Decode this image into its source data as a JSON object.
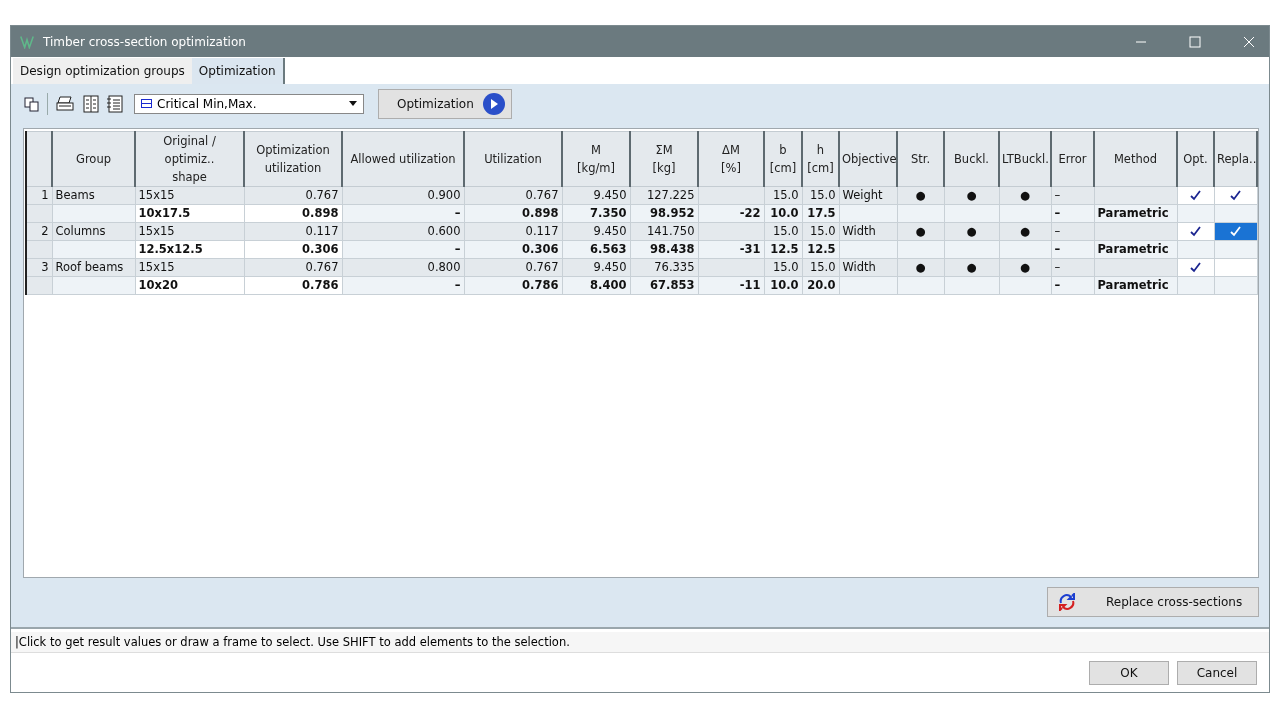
{
  "window": {
    "title": "Timber cross-section optimization"
  },
  "tabs": [
    {
      "label": "Design optimization groups",
      "selected": false
    },
    {
      "label": "Optimization",
      "selected": true
    }
  ],
  "toolbar": {
    "dropdown": {
      "value": "Critical Min,Max."
    },
    "run_button": "Optimization"
  },
  "table": {
    "columns": [
      "",
      "Group",
      "Original / optimiz..\nshape",
      "Optimization\nutilization",
      "Allowed utilization",
      "Utilization",
      "M\n[kg/m]",
      "ΣM\n[kg]",
      "ΔM\n[%]",
      "b\n[cm]",
      "h\n[cm]",
      "Objective",
      "Str.",
      "Buckl.",
      "LTBuckl.",
      "Error",
      "Method",
      "Opt.",
      "Repla.."
    ],
    "rows": [
      {
        "kind": "original",
        "cells": [
          "1",
          "Beams",
          "15x15",
          "0.767",
          "0.900",
          "0.767",
          "9.450",
          "127.225",
          "",
          "15.0",
          "15.0",
          "Weight",
          "●",
          "●",
          "●",
          "–",
          ""
        ],
        "opt": true,
        "replace": true,
        "replace_selected": false
      },
      {
        "kind": "optimized",
        "cells": [
          "",
          "",
          "10x17.5",
          "0.898",
          "–",
          "0.898",
          "7.350",
          "98.952",
          "-22",
          "10.0",
          "17.5",
          "",
          "",
          "",
          "",
          "–",
          "Parametric"
        ]
      },
      {
        "kind": "original",
        "cells": [
          "2",
          "Columns",
          "15x15",
          "0.117",
          "0.600",
          "0.117",
          "9.450",
          "141.750",
          "",
          "15.0",
          "15.0",
          "Width",
          "●",
          "●",
          "●",
          "–",
          ""
        ],
        "opt": true,
        "replace": true,
        "replace_selected": true
      },
      {
        "kind": "optimized",
        "cells": [
          "",
          "",
          "12.5x12.5",
          "0.306",
          "–",
          "0.306",
          "6.563",
          "98.438",
          "-31",
          "12.5",
          "12.5",
          "",
          "",
          "",
          "",
          "–",
          "Parametric"
        ]
      },
      {
        "kind": "original",
        "cells": [
          "3",
          "Roof beams",
          "15x15",
          "0.767",
          "0.800",
          "0.767",
          "9.450",
          "76.335",
          "",
          "15.0",
          "15.0",
          "Width",
          "●",
          "●",
          "●",
          "–",
          ""
        ],
        "opt": true,
        "replace": false,
        "replace_selected": false
      },
      {
        "kind": "optimized",
        "cells": [
          "",
          "",
          "10x20",
          "0.786",
          "–",
          "0.786",
          "8.400",
          "67.853",
          "-11",
          "10.0",
          "20.0",
          "",
          "",
          "",
          "",
          "–",
          "Parametric"
        ]
      }
    ]
  },
  "replace_button": "Replace cross-sections",
  "status_bar": "|Click to get result values or draw a frame to select. Use SHIFT to add elements to the selection.",
  "buttons": [
    "OK",
    "Cancel"
  ]
}
